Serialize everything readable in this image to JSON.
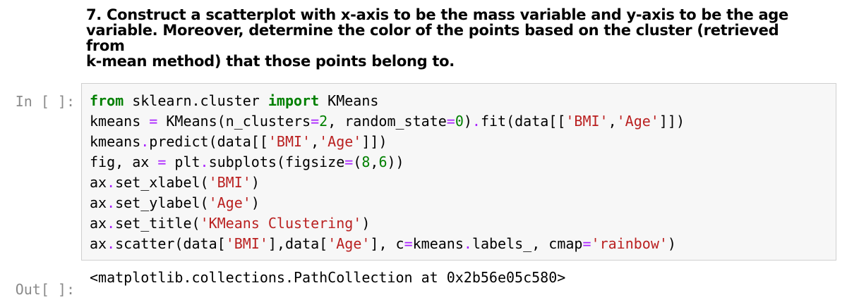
{
  "markdown": {
    "heading": "7. Construct a scatterplot with x-axis to be the mass variable and y-axis to be the age\nvariable. Moreover, determine the color of the points based on the cluster (retrieved from\nk-mean method) that those points belong to."
  },
  "code_cell": {
    "prompt": "In [ ]:",
    "lines": [
      [
        {
          "t": "from",
          "c": "kw"
        },
        {
          "t": " sklearn.cluster ",
          "c": ""
        },
        {
          "t": "import",
          "c": "kw"
        },
        {
          "t": " KMeans",
          "c": ""
        }
      ],
      [
        {
          "t": "kmeans ",
          "c": ""
        },
        {
          "t": "=",
          "c": "op"
        },
        {
          "t": " KMeans(n_clusters",
          "c": ""
        },
        {
          "t": "=",
          "c": "op"
        },
        {
          "t": "2",
          "c": "num"
        },
        {
          "t": ", random_state",
          "c": ""
        },
        {
          "t": "=",
          "c": "op"
        },
        {
          "t": "0",
          "c": "num"
        },
        {
          "t": ")",
          "c": ""
        },
        {
          "t": ".",
          "c": "op"
        },
        {
          "t": "fit(data[[",
          "c": ""
        },
        {
          "t": "'BMI'",
          "c": "str"
        },
        {
          "t": ",",
          "c": ""
        },
        {
          "t": "'Age'",
          "c": "str"
        },
        {
          "t": "]])",
          "c": ""
        }
      ],
      [
        {
          "t": "kmeans",
          "c": ""
        },
        {
          "t": ".",
          "c": "op"
        },
        {
          "t": "predict(data[[",
          "c": ""
        },
        {
          "t": "'BMI'",
          "c": "str"
        },
        {
          "t": ",",
          "c": ""
        },
        {
          "t": "'Age'",
          "c": "str"
        },
        {
          "t": "]])",
          "c": ""
        }
      ],
      [
        {
          "t": "fig, ax ",
          "c": ""
        },
        {
          "t": "=",
          "c": "op"
        },
        {
          "t": " plt",
          "c": ""
        },
        {
          "t": ".",
          "c": "op"
        },
        {
          "t": "subplots(figsize",
          "c": ""
        },
        {
          "t": "=",
          "c": "op"
        },
        {
          "t": "(",
          "c": ""
        },
        {
          "t": "8",
          "c": "num"
        },
        {
          "t": ",",
          "c": ""
        },
        {
          "t": "6",
          "c": "num"
        },
        {
          "t": "))",
          "c": ""
        }
      ],
      [
        {
          "t": "ax",
          "c": ""
        },
        {
          "t": ".",
          "c": "op"
        },
        {
          "t": "set_xlabel(",
          "c": ""
        },
        {
          "t": "'BMI'",
          "c": "str"
        },
        {
          "t": ")",
          "c": ""
        }
      ],
      [
        {
          "t": "ax",
          "c": ""
        },
        {
          "t": ".",
          "c": "op"
        },
        {
          "t": "set_ylabel(",
          "c": ""
        },
        {
          "t": "'Age'",
          "c": "str"
        },
        {
          "t": ")",
          "c": ""
        }
      ],
      [
        {
          "t": "ax",
          "c": ""
        },
        {
          "t": ".",
          "c": "op"
        },
        {
          "t": "set_title(",
          "c": ""
        },
        {
          "t": "'KMeans Clustering'",
          "c": "str"
        },
        {
          "t": ")",
          "c": ""
        }
      ],
      [
        {
          "t": "ax",
          "c": ""
        },
        {
          "t": ".",
          "c": "op"
        },
        {
          "t": "scatter(data[",
          "c": ""
        },
        {
          "t": "'BMI'",
          "c": "str"
        },
        {
          "t": "],data[",
          "c": ""
        },
        {
          "t": "'Age'",
          "c": "str"
        },
        {
          "t": "], c",
          "c": ""
        },
        {
          "t": "=",
          "c": "op"
        },
        {
          "t": "kmeans",
          "c": ""
        },
        {
          "t": ".",
          "c": "op"
        },
        {
          "t": "labels_, cmap",
          "c": ""
        },
        {
          "t": "=",
          "c": "op"
        },
        {
          "t": "'rainbow'",
          "c": "str"
        },
        {
          "t": ")",
          "c": ""
        }
      ]
    ]
  },
  "output_cell": {
    "prompt": "Out[ ]:",
    "text": "<matplotlib.collections.PathCollection at 0x2b56e05c580>"
  },
  "colors": {
    "keyword": "#008000",
    "operator": "#aa22ff",
    "string": "#ba2121",
    "number": "#008000",
    "prompt": "#8a8a8a",
    "code_background": "#f7f7f7"
  }
}
